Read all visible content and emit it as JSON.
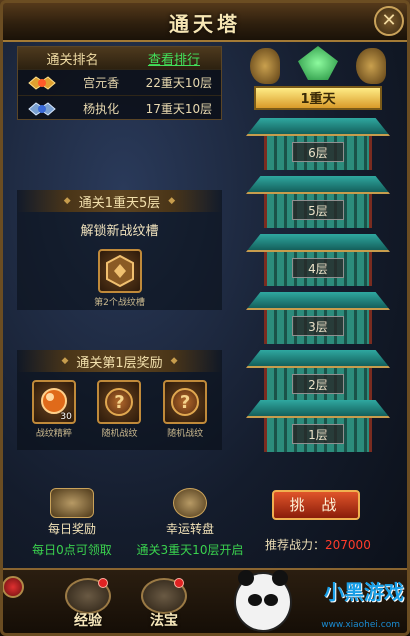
{
  "window": {
    "title": "通天塔",
    "close_icon": "close-x-icon"
  },
  "ranking": {
    "header_label": "通关排名",
    "view_link": "查看排行",
    "rows": [
      {
        "badge_icon": "gold-rank-badge-icon",
        "name": "宫元香",
        "progress": "22重天10层"
      },
      {
        "badge_icon": "silver-rank-badge-icon",
        "name": "杨执化",
        "progress": "17重天10层"
      }
    ]
  },
  "milestone1": {
    "title": "通关1重天5层",
    "unlock_text": "解锁新战纹槽",
    "item": {
      "icon": "war-pattern-slot-icon",
      "caption": "第2个战纹槽"
    }
  },
  "milestone2": {
    "title": "通关第1层奖励",
    "items": [
      {
        "icon": "orb-icon",
        "caption": "战纹精粹",
        "count": "30"
      },
      {
        "icon": "question-mark-icon",
        "caption": "随机战纹"
      },
      {
        "icon": "question-mark-icon",
        "caption": "随机战纹"
      }
    ]
  },
  "tower": {
    "current": "1重天",
    "floors": [
      "6层",
      "5层",
      "4层",
      "3层",
      "2层",
      "1层"
    ]
  },
  "bottom": {
    "daily": {
      "label": "每日奖励",
      "sub": "每日0点可领取"
    },
    "wheel": {
      "label": "幸运转盘",
      "sub": "通关3重天10层开启"
    },
    "challenge_label": "挑 战",
    "power_label": "推荐战力：",
    "power_value": "207000"
  },
  "nav": {
    "items": [
      {
        "label": "经验"
      },
      {
        "label": "法宝"
      }
    ],
    "watermark": "小黑游戏",
    "watermark_url": "www.xiaohei.com"
  },
  "colors": {
    "accent_green": "#3ad24e",
    "power_red": "#ff3b2a",
    "gold": "#c9a25a"
  }
}
